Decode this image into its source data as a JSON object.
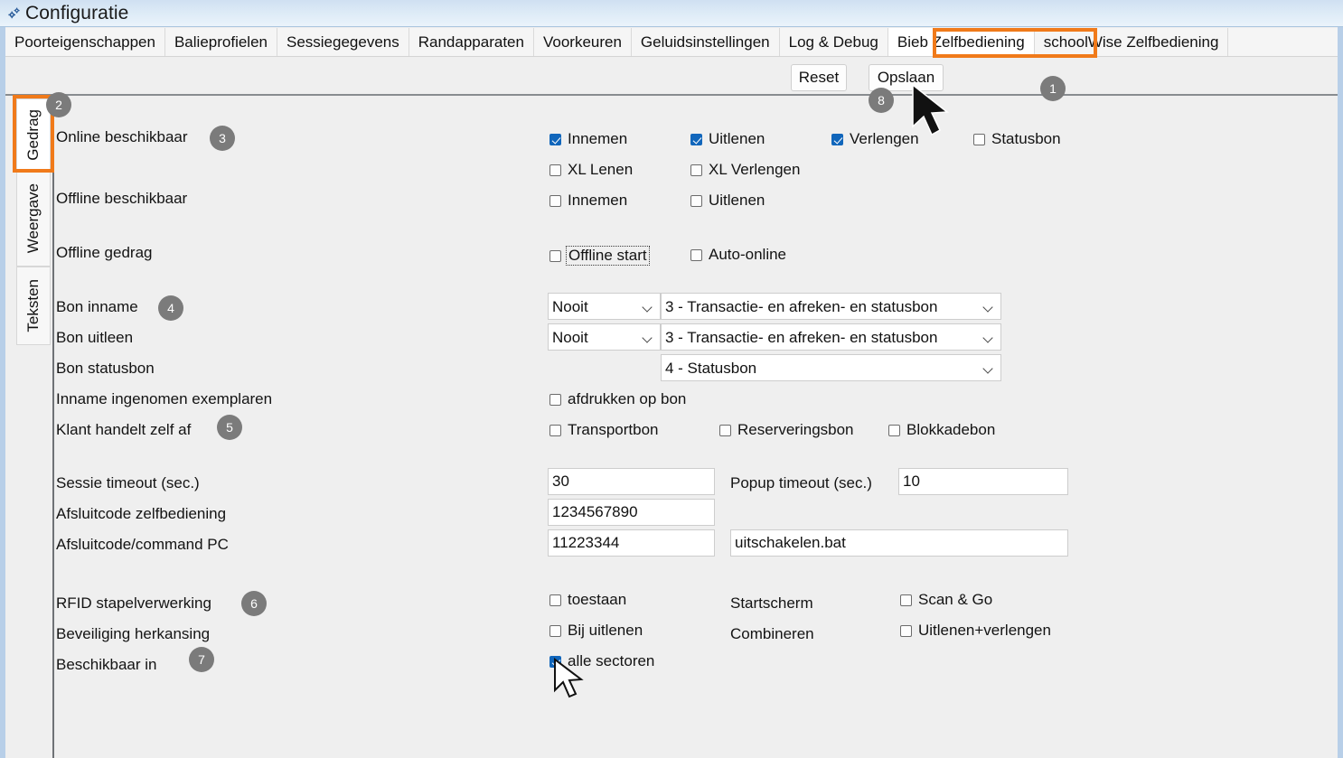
{
  "window": {
    "title": "Configuratie",
    "icon": "gears-icon"
  },
  "tabs": [
    {
      "label": "Poorteigenschappen",
      "selected": false
    },
    {
      "label": "Balieprofielen",
      "selected": false
    },
    {
      "label": "Sessiegegevens",
      "selected": false
    },
    {
      "label": "Randapparaten",
      "selected": false
    },
    {
      "label": "Voorkeuren",
      "selected": false
    },
    {
      "label": "Geluidsinstellingen",
      "selected": false
    },
    {
      "label": "Log & Debug",
      "selected": false
    },
    {
      "label": "Bieb Zelfbediening",
      "selected": true
    },
    {
      "label": "schoolWise Zelfbediening",
      "selected": false
    }
  ],
  "toolbar": {
    "reset_label": "Reset",
    "opslaan_label": "Opslaan"
  },
  "side_tabs": [
    {
      "label": "Gedrag",
      "selected": true
    },
    {
      "label": "Weergave",
      "selected": false
    },
    {
      "label": "Teksten",
      "selected": false
    }
  ],
  "form": {
    "labels": {
      "online_beschikbaar": "Online beschikbaar",
      "offline_beschikbaar": "Offline beschikbaar",
      "offline_gedrag": "Offline gedrag",
      "bon_inname": "Bon inname",
      "bon_uitleen": "Bon uitleen",
      "bon_statusbon": "Bon statusbon",
      "inname_ingenomen": "Inname ingenomen exemplaren",
      "klant_handelt": "Klant handelt zelf af",
      "sessie_timeout": "Sessie timeout (sec.)",
      "afsluitcode_zelfbediening": "Afsluitcode zelfbediening",
      "afsluitcode_command": "Afsluitcode/command PC",
      "rfid_stapelverwerking": "RFID stapelverwerking",
      "beveiliging_herkansing": "Beveiliging herkansing",
      "beschikbaar_in": "Beschikbaar in",
      "popup_timeout": "Popup timeout (sec.)",
      "startscherm": "Startscherm",
      "combineren": "Combineren"
    },
    "checkboxes": {
      "innemen_online": {
        "label": "Innemen",
        "checked": true
      },
      "uitlenen_online": {
        "label": "Uitlenen",
        "checked": true
      },
      "verlengen_online": {
        "label": "Verlengen",
        "checked": true
      },
      "statusbon_online": {
        "label": "Statusbon",
        "checked": false
      },
      "xl_lenen": {
        "label": "XL Lenen",
        "checked": false
      },
      "xl_verlengen": {
        "label": "XL Verlengen",
        "checked": false
      },
      "innemen_offline": {
        "label": "Innemen",
        "checked": false
      },
      "uitlenen_offline": {
        "label": "Uitlenen",
        "checked": false
      },
      "offline_start": {
        "label": "Offline start",
        "checked": false,
        "focused": true
      },
      "auto_online": {
        "label": "Auto-online",
        "checked": false
      },
      "afdrukken_op_bon": {
        "label": "afdrukken op bon",
        "checked": false
      },
      "transportbon": {
        "label": "Transportbon",
        "checked": false
      },
      "reserveringsbon": {
        "label": "Reserveringsbon",
        "checked": false
      },
      "blokkadebon": {
        "label": "Blokkadebon",
        "checked": false
      },
      "toestaan": {
        "label": "toestaan",
        "checked": false
      },
      "scan_en_go": {
        "label": "Scan & Go",
        "checked": false
      },
      "bij_uitlenen": {
        "label": "Bij uitlenen",
        "checked": false
      },
      "uitlenen_verlengen": {
        "label": "Uitlenen+verlengen",
        "checked": false
      },
      "alle_sectoren": {
        "label": "alle sectoren",
        "checked": true
      }
    },
    "dropdowns": {
      "bon_inname_freq": {
        "value": "Nooit",
        "options": [
          "Nooit"
        ]
      },
      "bon_inname_type": {
        "value": "3 - Transactie- en afreken- en statusbon",
        "options": [
          "3 - Transactie- en afreken- en statusbon"
        ]
      },
      "bon_uitleen_freq": {
        "value": "Nooit",
        "options": [
          "Nooit"
        ]
      },
      "bon_uitleen_type": {
        "value": "3 - Transactie- en afreken- en statusbon",
        "options": [
          "3 - Transactie- en afreken- en statusbon"
        ]
      },
      "bon_statusbon_type": {
        "value": "4 - Statusbon",
        "options": [
          "4 - Statusbon"
        ]
      }
    },
    "inputs": {
      "sessie_timeout": {
        "value": "30",
        "placeholder": ""
      },
      "popup_timeout": {
        "value": "10",
        "placeholder": ""
      },
      "afsluitcode_zelfbediening": {
        "value": "1234567890",
        "placeholder": ""
      },
      "afsluitcode_command": {
        "value": "11223344",
        "placeholder": ""
      },
      "command_pc": {
        "value": "uitschakelen.bat",
        "placeholder": ""
      }
    }
  },
  "annotations": [
    {
      "id": "1",
      "text": "1"
    },
    {
      "id": "2",
      "text": "2"
    },
    {
      "id": "3",
      "text": "3"
    },
    {
      "id": "4",
      "text": "4"
    },
    {
      "id": "5",
      "text": "5"
    },
    {
      "id": "6",
      "text": "6"
    },
    {
      "id": "7",
      "text": "7"
    },
    {
      "id": "8",
      "text": "8"
    }
  ],
  "colors": {
    "highlight": "#f07a1a",
    "checkbox_checked": "#1166bb",
    "badge": "#7b7b7b",
    "titlebar": "#cfe0f2"
  }
}
